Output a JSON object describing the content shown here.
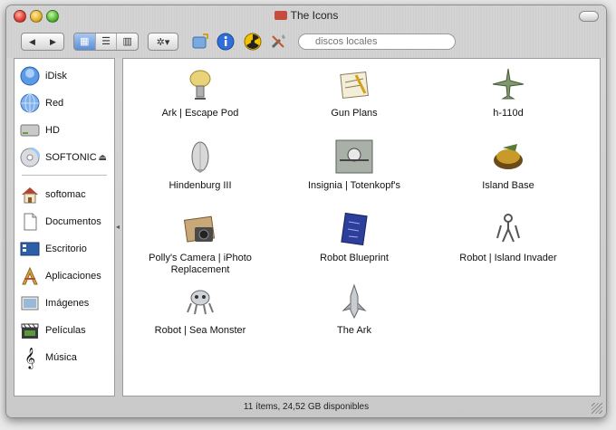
{
  "window": {
    "title": "The Icons"
  },
  "toolbar": {
    "back": "◀",
    "forward": "▶",
    "views": [
      "▦",
      "☰",
      "▥"
    ],
    "action": "✲▾",
    "search_placeholder": "discos locales"
  },
  "sidebar": {
    "devices": [
      {
        "label": "iDisk",
        "icon": "idisk-icon"
      },
      {
        "label": "Red",
        "icon": "network-icon"
      },
      {
        "label": "HD",
        "icon": "harddisk-icon"
      },
      {
        "label": "SOFTONIC",
        "icon": "cd-disk-icon",
        "eject": "⏏"
      }
    ],
    "places": [
      {
        "label": "softomac",
        "icon": "home-icon"
      },
      {
        "label": "Documentos",
        "icon": "documents-icon"
      },
      {
        "label": "Escritorio",
        "icon": "desktop-icon"
      },
      {
        "label": "Aplicaciones",
        "icon": "applications-icon"
      },
      {
        "label": "Imágenes",
        "icon": "pictures-icon"
      },
      {
        "label": "Películas",
        "icon": "movies-icon"
      },
      {
        "label": "Música",
        "icon": "music-icon"
      }
    ]
  },
  "files": [
    {
      "label": "Ark | Escape Pod",
      "icon": "escape-pod-icon"
    },
    {
      "label": "Gun Plans",
      "icon": "gun-plans-icon"
    },
    {
      "label": "h-110d",
      "icon": "airplane-icon"
    },
    {
      "label": "Hindenburg III",
      "icon": "zeppelin-icon"
    },
    {
      "label": "Insignia | Totenkopf's",
      "icon": "insignia-icon"
    },
    {
      "label": "Island Base",
      "icon": "island-base-icon"
    },
    {
      "label": "Polly's Camera | iPhoto Replacement",
      "icon": "camera-icon"
    },
    {
      "label": "Robot Blueprint",
      "icon": "blueprint-icon"
    },
    {
      "label": "Robot | Island Invader",
      "icon": "robot-invader-icon"
    },
    {
      "label": "Robot | Sea Monster",
      "icon": "sea-monster-icon"
    },
    {
      "label": "The Ark",
      "icon": "ark-icon"
    }
  ],
  "status": {
    "text": "11 ítems, 24,52 GB disponibles"
  }
}
